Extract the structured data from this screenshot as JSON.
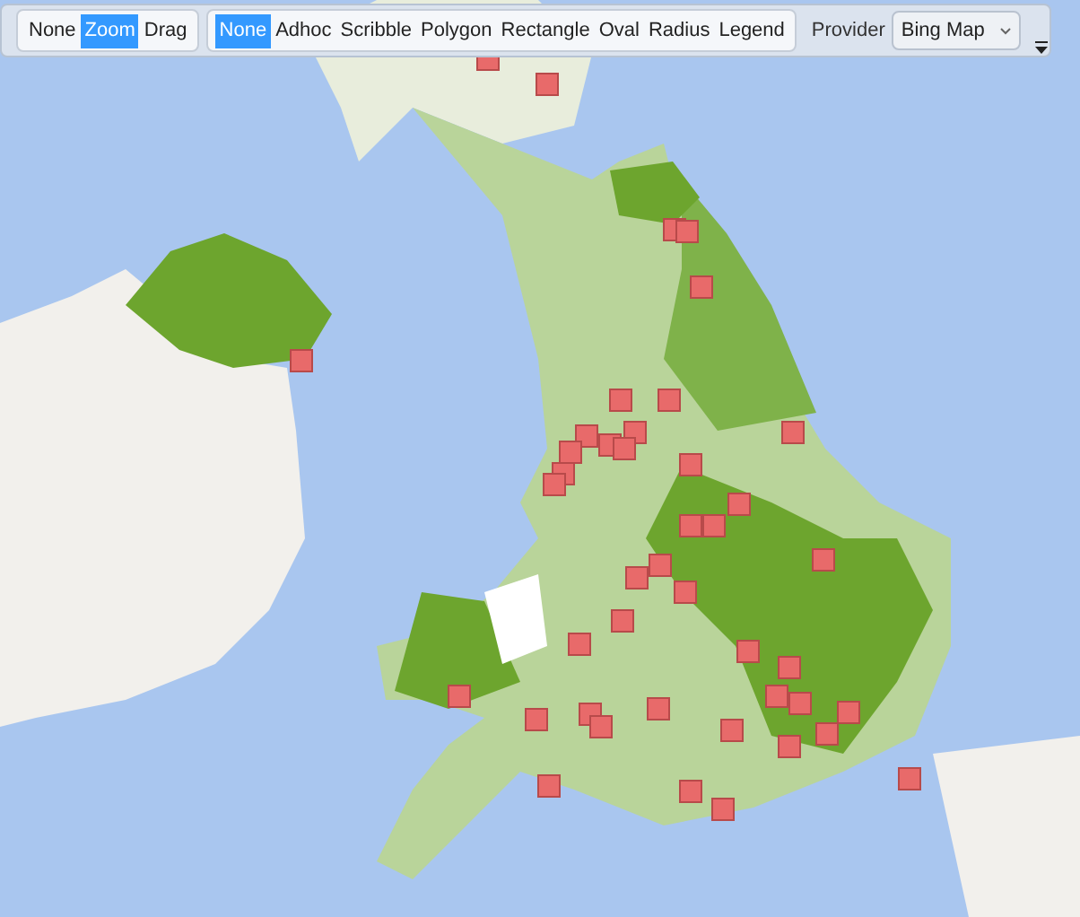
{
  "toolbar": {
    "navigation_modes": [
      {
        "label": "None",
        "selected": false
      },
      {
        "label": "Zoom",
        "selected": true
      },
      {
        "label": "Drag",
        "selected": false
      }
    ],
    "selection_tools": [
      {
        "label": "None",
        "selected": true
      },
      {
        "label": "Adhoc",
        "selected": false
      },
      {
        "label": "Scribble",
        "selected": false
      },
      {
        "label": "Polygon",
        "selected": false
      },
      {
        "label": "Rectangle",
        "selected": false
      },
      {
        "label": "Oval",
        "selected": false
      },
      {
        "label": "Radius",
        "selected": false
      },
      {
        "label": "Legend",
        "selected": false
      }
    ],
    "provider": {
      "label": "Provider",
      "value": "Bing Map"
    }
  }
}
